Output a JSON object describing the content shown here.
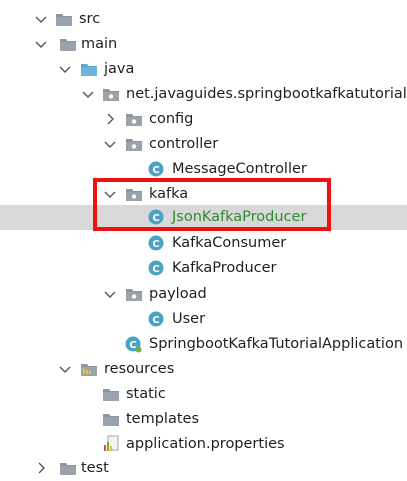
{
  "tree": {
    "rows": [
      {
        "label": "src",
        "expanded": true,
        "icon": "folder-icon"
      },
      {
        "label": "main",
        "expanded": true,
        "icon": "folder-icon"
      },
      {
        "label": "java",
        "expanded": true,
        "icon": "source-folder-icon"
      },
      {
        "label": "net.javaguides.springbootkafkatutorial",
        "expanded": true,
        "icon": "package-icon"
      },
      {
        "label": "config",
        "expanded": false,
        "icon": "package-icon"
      },
      {
        "label": "controller",
        "expanded": true,
        "icon": "package-icon"
      },
      {
        "label": "MessageController",
        "icon": "class-icon"
      },
      {
        "label": "kafka",
        "expanded": true,
        "icon": "package-icon"
      },
      {
        "label": "JsonKafkaProducer",
        "icon": "class-icon",
        "selected": true
      },
      {
        "label": "KafkaConsumer",
        "icon": "class-icon"
      },
      {
        "label": "KafkaProducer",
        "icon": "class-icon"
      },
      {
        "label": "payload",
        "expanded": true,
        "icon": "package-icon"
      },
      {
        "label": "User",
        "icon": "class-icon"
      },
      {
        "label": "SpringbootKafkaTutorialApplication",
        "icon": "spring-class-icon"
      },
      {
        "label": "resources",
        "expanded": true,
        "icon": "resources-folder-icon"
      },
      {
        "label": "static",
        "icon": "folder-icon"
      },
      {
        "label": "templates",
        "icon": "folder-icon"
      },
      {
        "label": "application.properties",
        "icon": "properties-file-icon"
      },
      {
        "label": "test",
        "expanded": false,
        "icon": "folder-icon"
      }
    ]
  },
  "colors": {
    "selection_bg": "#d9d9d9",
    "selected_text": "#2e8b2e",
    "highlight_border": "#ee1111",
    "class_icon": "#4aa3c4",
    "folder_icon": "#8c96a0"
  }
}
